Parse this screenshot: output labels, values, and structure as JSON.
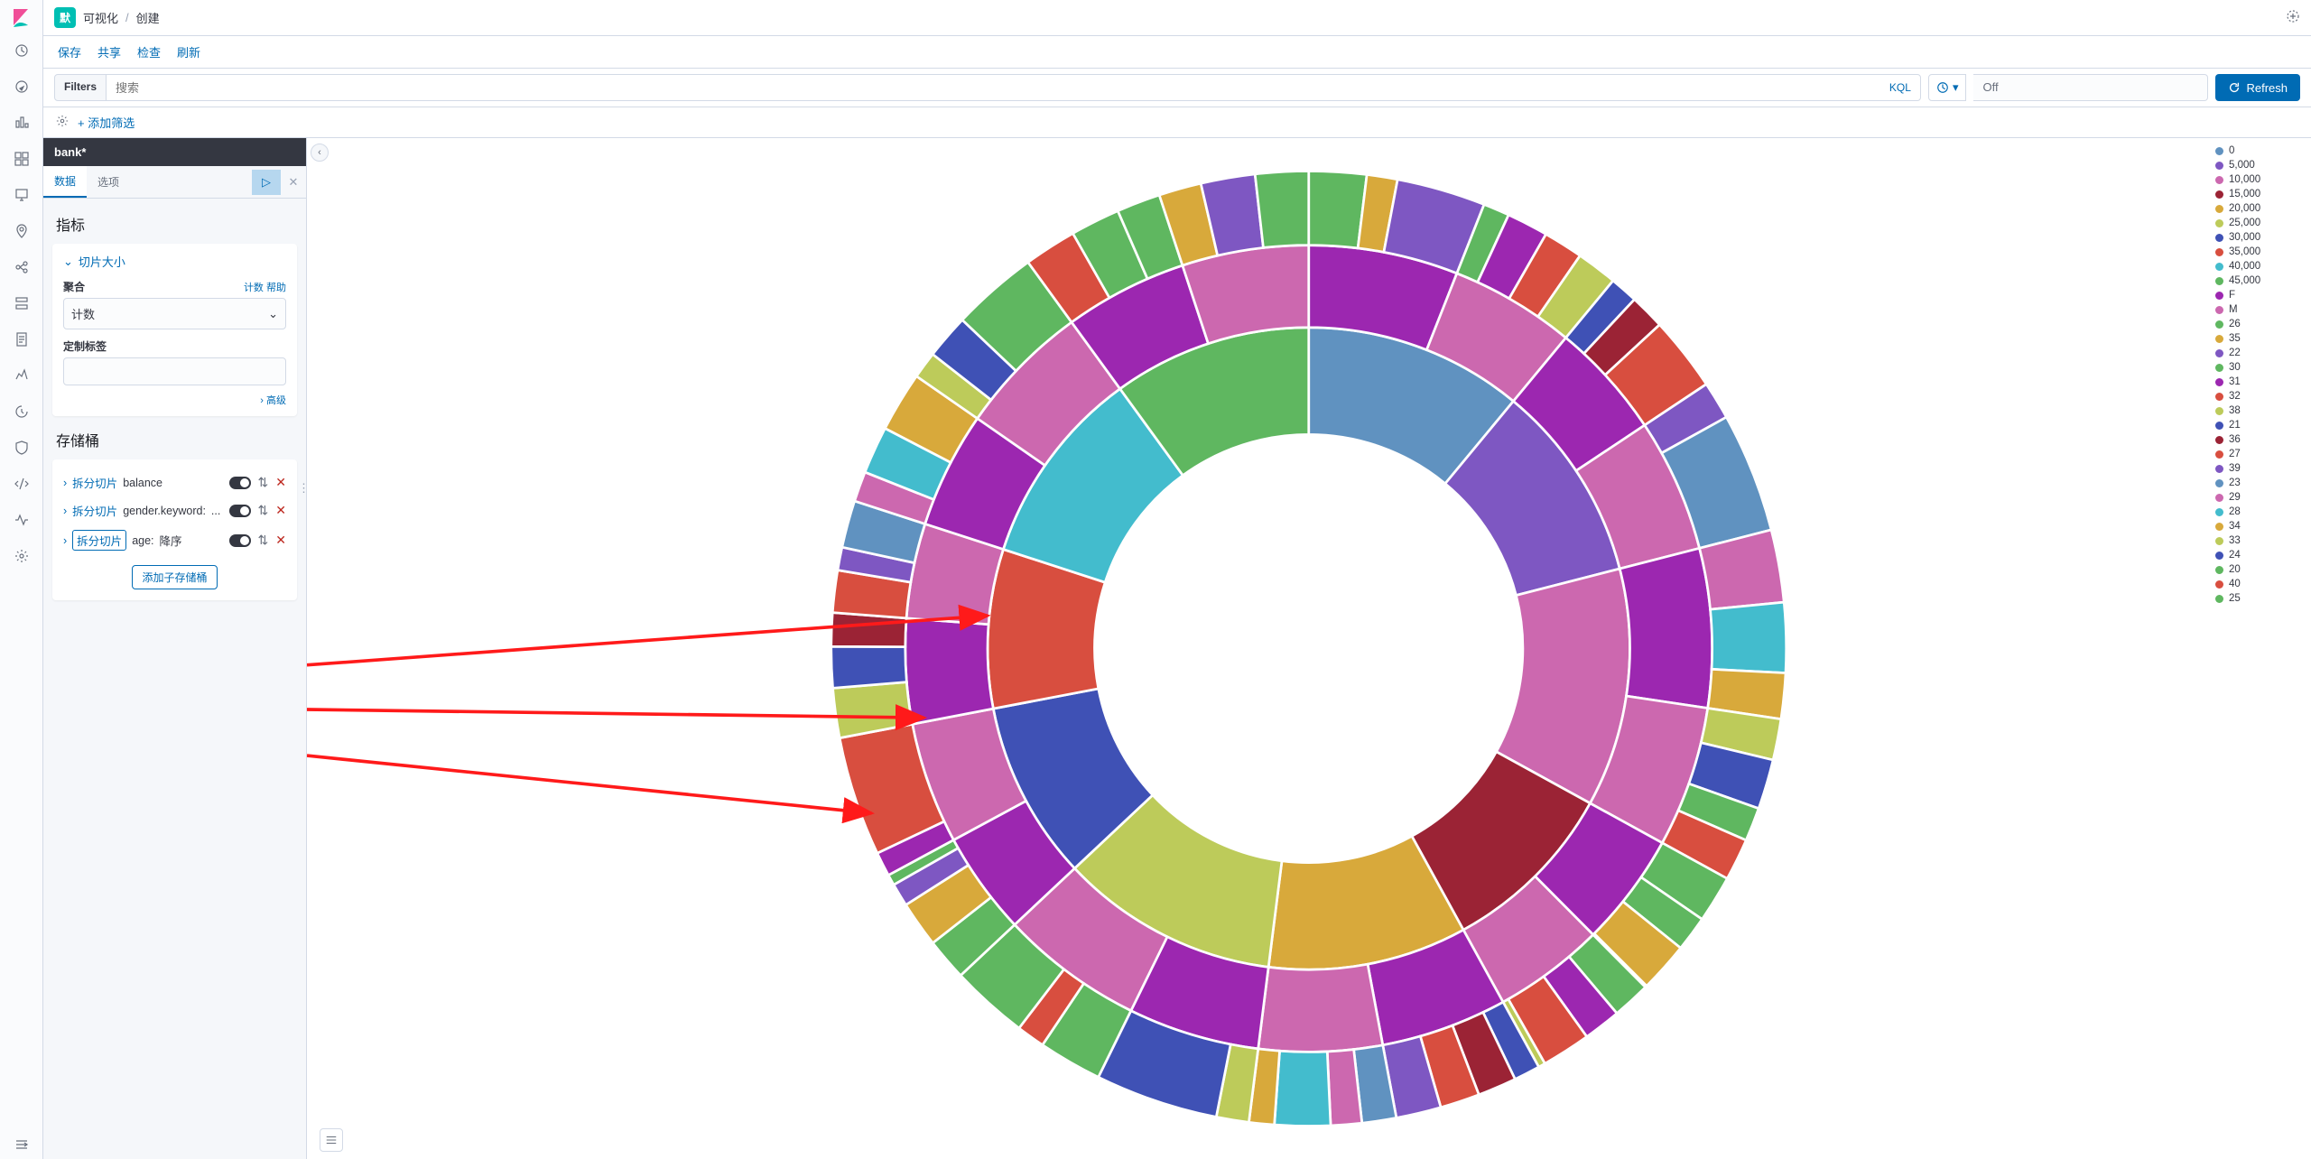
{
  "breadcrumb": {
    "badge": "默",
    "item1": "可视化",
    "item2": "创建"
  },
  "actions": {
    "save": "保存",
    "share": "共享",
    "inspect": "检查",
    "refresh": "刷新"
  },
  "filterbar": {
    "filters_label": "Filters",
    "search_placeholder": "搜索",
    "kql": "KQL",
    "time_off": "Off",
    "refresh_btn": "Refresh"
  },
  "addfilter": "+ 添加筛选",
  "panel": {
    "title": "bank*",
    "tabs": {
      "data": "数据",
      "options": "选项"
    },
    "metrics_header": "指标",
    "slice_size": "切片大小",
    "agg_label": "聚合",
    "agg_help": "计数 帮助",
    "agg_value": "计数",
    "custom_label": "定制标签",
    "advanced": "高级",
    "buckets_header": "存储桶",
    "bucket_rows": [
      {
        "type": "拆分切片",
        "field": "balance",
        "sort": "",
        "boxed": false
      },
      {
        "type": "拆分切片",
        "field": "gender.keyword:",
        "sort": "...",
        "boxed": false
      },
      {
        "type": "拆分切片",
        "field": "age:",
        "sort": "降序",
        "boxed": true
      }
    ],
    "add_sub_bucket": "添加子存储桶"
  },
  "legend": [
    {
      "label": "0",
      "color": "#6092c0"
    },
    {
      "label": "5,000",
      "color": "#7e57c2"
    },
    {
      "label": "10,000",
      "color": "#cc68af"
    },
    {
      "label": "15,000",
      "color": "#9b2335"
    },
    {
      "label": "20,000",
      "color": "#d8a93b"
    },
    {
      "label": "25,000",
      "color": "#bdcb5a"
    },
    {
      "label": "30,000",
      "color": "#3f51b5"
    },
    {
      "label": "35,000",
      "color": "#d84e3f"
    },
    {
      "label": "40,000",
      "color": "#43bccd"
    },
    {
      "label": "45,000",
      "color": "#5fb760"
    },
    {
      "label": "F",
      "color": "#9c27b0"
    },
    {
      "label": "M",
      "color": "#cc68af"
    },
    {
      "label": "26",
      "color": "#5fb760"
    },
    {
      "label": "35",
      "color": "#d8a93b"
    },
    {
      "label": "22",
      "color": "#7e57c2"
    },
    {
      "label": "30",
      "color": "#5fb760"
    },
    {
      "label": "31",
      "color": "#9c27b0"
    },
    {
      "label": "32",
      "color": "#d84e3f"
    },
    {
      "label": "38",
      "color": "#bdcb5a"
    },
    {
      "label": "21",
      "color": "#3f51b5"
    },
    {
      "label": "36",
      "color": "#9b2335"
    },
    {
      "label": "27",
      "color": "#d84e3f"
    },
    {
      "label": "39",
      "color": "#7e57c2"
    },
    {
      "label": "23",
      "color": "#6092c0"
    },
    {
      "label": "29",
      "color": "#cc68af"
    },
    {
      "label": "28",
      "color": "#43bccd"
    },
    {
      "label": "34",
      "color": "#d8a93b"
    },
    {
      "label": "33",
      "color": "#bdcb5a"
    },
    {
      "label": "24",
      "color": "#3f51b5"
    },
    {
      "label": "20",
      "color": "#5fb760"
    },
    {
      "label": "40",
      "color": "#d84e3f"
    },
    {
      "label": "25",
      "color": "#5fb760"
    }
  ],
  "chart_data": {
    "type": "sunburst",
    "rings": [
      {
        "name": "balance",
        "slices": [
          {
            "label": "0",
            "value": 11,
            "color": "#6092c0"
          },
          {
            "label": "5,000",
            "value": 10,
            "color": "#7e57c2"
          },
          {
            "label": "10,000",
            "value": 12,
            "color": "#cc68af"
          },
          {
            "label": "15,000",
            "value": 9,
            "color": "#9b2335"
          },
          {
            "label": "20,000",
            "value": 10,
            "color": "#d8a93b"
          },
          {
            "label": "25,000",
            "value": 11,
            "color": "#bdcb5a"
          },
          {
            "label": "30,000",
            "value": 9,
            "color": "#3f51b5"
          },
          {
            "label": "35,000",
            "value": 8,
            "color": "#d84e3f"
          },
          {
            "label": "40,000",
            "value": 10,
            "color": "#43bccd"
          },
          {
            "label": "45,000",
            "value": 10,
            "color": "#5fb760"
          }
        ]
      },
      {
        "name": "gender.keyword",
        "splits_per_parent": 2,
        "palette": [
          "#9c27b0",
          "#cc68af"
        ]
      },
      {
        "name": "age",
        "splits_per_parent": 3,
        "palette": [
          "#5fb760",
          "#d8a93b",
          "#7e57c2",
          "#5fb760",
          "#9c27b0",
          "#d84e3f",
          "#bdcb5a",
          "#3f51b5",
          "#9b2335",
          "#d84e3f",
          "#7e57c2",
          "#6092c0",
          "#cc68af",
          "#43bccd",
          "#d8a93b",
          "#bdcb5a",
          "#3f51b5",
          "#5fb760",
          "#d84e3f",
          "#5fb760"
        ]
      }
    ]
  }
}
